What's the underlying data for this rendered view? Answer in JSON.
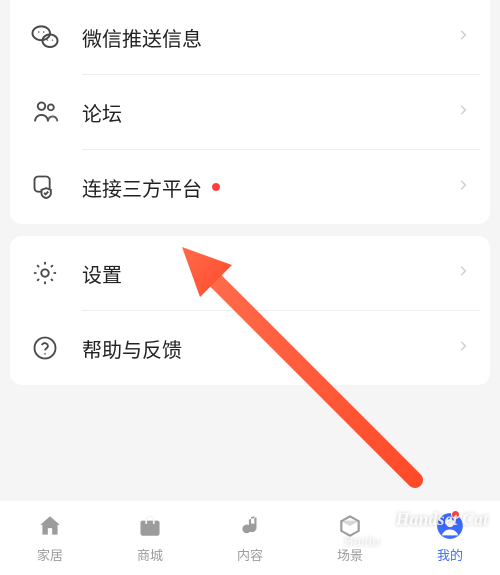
{
  "group1": {
    "items": [
      {
        "label": "微信推送信息"
      },
      {
        "label": "论坛"
      },
      {
        "label": "连接三方平台",
        "has_dot": true
      }
    ]
  },
  "group2": {
    "items": [
      {
        "label": "设置"
      },
      {
        "label": "帮助与反馈"
      }
    ]
  },
  "tabs": [
    {
      "label": "家居"
    },
    {
      "label": "商城"
    },
    {
      "label": "内容"
    },
    {
      "label": "场景"
    },
    {
      "label": "我的"
    }
  ],
  "watermark": "Handset Cat",
  "watermark2": "Baidu"
}
